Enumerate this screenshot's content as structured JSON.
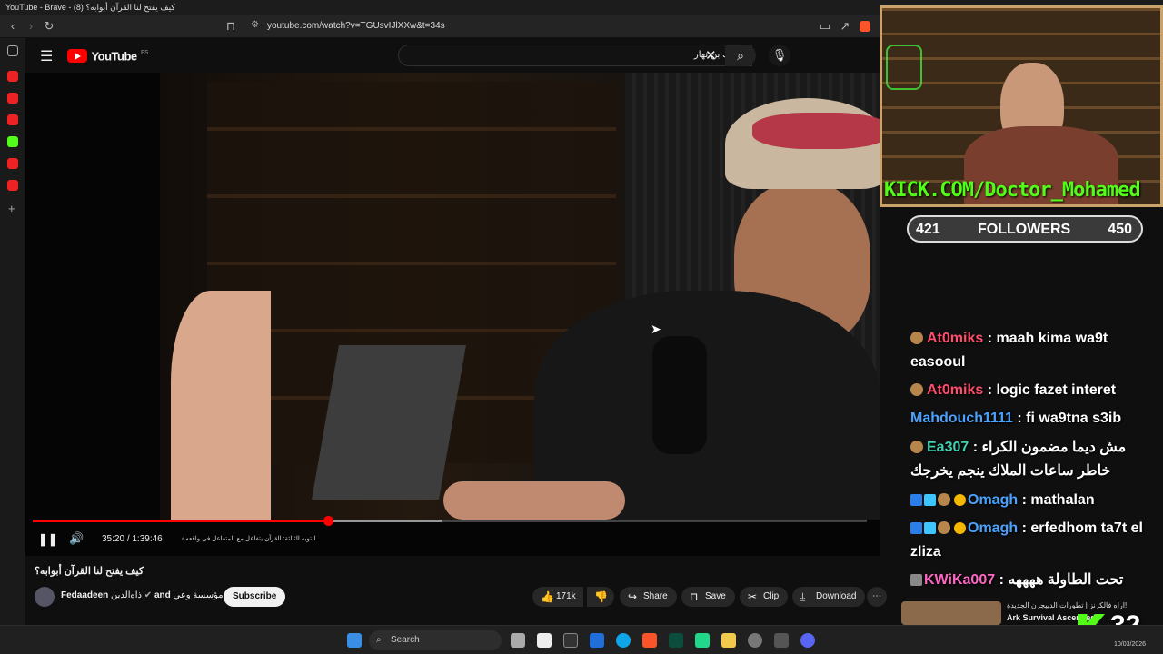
{
  "browser": {
    "tab_title": "YouTube - Brave - كيف يفتح لنا القرآن أبوابه؟ (8)",
    "url": "youtube.com/watch?v=TGUsvIJlXXw&t=34s"
  },
  "youtube": {
    "logo_text": "YouTube",
    "region": "ES",
    "search_value": "مالك بن نهار"
  },
  "player": {
    "time_current": "35:20",
    "time_total": "1:39:46",
    "time_separator": "/",
    "chapter": "التوبه الثالثة: القرآن يتفاعل مع المتفاعل في واقعه",
    "progress_fraction": 0.354,
    "buffer_fraction": 0.49
  },
  "video": {
    "title": "كيف يفتح لنا القرآن أبوابه؟",
    "channel": "Fedaadeen",
    "collab_a": "ذاه‌الدين",
    "collab_and": "and",
    "collab_b": "مؤسسة وعي",
    "subscribe": "Subscribe",
    "likes": "171k",
    "share": "Share",
    "save": "Save",
    "clip": "Clip",
    "download": "Download"
  },
  "stream": {
    "kick_url": "KICK.COM/Doctor_Mohamed",
    "followers_current": "421",
    "followers_label": "FOLLOWERS",
    "followers_goal": "450",
    "chat": [
      {
        "user": "At0miks",
        "text": ": maah kima wa9t easooul",
        "color": "#ff4d6d"
      },
      {
        "user": "At0miks",
        "text": ": logic fazet interet",
        "color": "#ff4d6d"
      },
      {
        "user": "Mahdouch1111",
        "text": ": fi wa9tna s3ib",
        "color": "#4aa3ff"
      },
      {
        "user": "Ea307",
        "text": ": مش ديما مضمون الكراء خاطر ساعات الملاك ينجم يخرجك",
        "color": "#3fd1b0"
      },
      {
        "user": "Omagh",
        "text": ": mathalan",
        "color": "#4aa3ff"
      },
      {
        "user": "Omagh",
        "text": ": erfedhom ta7t el zliza",
        "color": "#4aa3ff"
      },
      {
        "user": "KWiKa007",
        "text": ": تحت الطاولة ههههه",
        "color": "#ff66c4"
      }
    ],
    "rec_title": "اراه فالكرنز | تطورات الدبيجرن الجديدة!",
    "rec_subtitle": "Ark Survival Ascended",
    "counter": "32"
  },
  "taskbar": {
    "search_placeholder": "Search",
    "date": "10/03/2026"
  },
  "colors": {
    "youtube_red": "#ff0000",
    "kick_green": "#53fc18"
  }
}
